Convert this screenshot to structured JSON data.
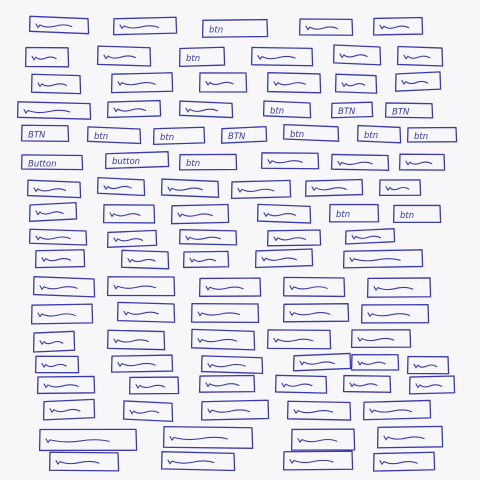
{
  "ink_color": "#3a3aa8",
  "paper_color": "#f7f7f9",
  "rows": [
    {
      "boxes": [
        {
          "label": ""
        },
        {
          "label": ""
        },
        {
          "label": "btn"
        },
        {
          "label": ""
        },
        {
          "label": ""
        }
      ]
    },
    {
      "boxes": [
        {
          "label": ""
        },
        {
          "label": ""
        },
        {
          "label": "btn"
        },
        {
          "label": ""
        },
        {
          "label": ""
        },
        {
          "label": ""
        }
      ]
    },
    {
      "boxes": [
        {
          "label": ""
        },
        {
          "label": ""
        },
        {
          "label": ""
        },
        {
          "label": ""
        },
        {
          "label": ""
        },
        {
          "label": ""
        }
      ]
    },
    {
      "boxes": [
        {
          "label": ""
        },
        {
          "label": ""
        },
        {
          "label": ""
        },
        {
          "label": "btn"
        },
        {
          "label": "BTN"
        },
        {
          "label": "BTN"
        }
      ]
    },
    {
      "boxes": [
        {
          "label": "BTN"
        },
        {
          "label": "btn"
        },
        {
          "label": "btn"
        },
        {
          "label": "BTN"
        },
        {
          "label": "btn"
        },
        {
          "label": "btn"
        },
        {
          "label": "btn"
        }
      ]
    },
    {
      "boxes": [
        {
          "label": "Button"
        },
        {
          "label": "button"
        },
        {
          "label": "btn"
        },
        {
          "label": ""
        },
        {
          "label": ""
        },
        {
          "label": ""
        },
        {
          "label": ""
        }
      ]
    },
    {
      "boxes": [
        {
          "label": ""
        },
        {
          "label": ""
        },
        {
          "label": ""
        },
        {
          "label": ""
        },
        {
          "label": ""
        },
        {
          "label": ""
        }
      ]
    },
    {
      "boxes": [
        {
          "label": ""
        },
        {
          "label": ""
        },
        {
          "label": ""
        },
        {
          "label": ""
        },
        {
          "label": "btn"
        },
        {
          "label": "btn"
        }
      ]
    },
    {
      "boxes": [
        {
          "label": ""
        },
        {
          "label": ""
        },
        {
          "label": ""
        },
        {
          "label": ""
        },
        {
          "label": ""
        }
      ]
    },
    {
      "boxes": [
        {
          "label": ""
        },
        {
          "label": ""
        },
        {
          "label": ""
        },
        {
          "label": ""
        },
        {
          "label": ""
        }
      ]
    },
    {
      "boxes": [
        {
          "label": ""
        },
        {
          "label": ""
        },
        {
          "label": ""
        },
        {
          "label": ""
        },
        {
          "label": ""
        }
      ]
    },
    {
      "boxes": [
        {
          "label": ""
        },
        {
          "label": ""
        },
        {
          "label": ""
        },
        {
          "label": ""
        },
        {
          "label": ""
        }
      ]
    },
    {
      "boxes": [
        {
          "label": ""
        },
        {
          "label": ""
        },
        {
          "label": ""
        },
        {
          "label": ""
        },
        {
          "label": ""
        }
      ]
    },
    {
      "boxes": [
        {
          "label": ""
        },
        {
          "label": ""
        },
        {
          "label": ""
        },
        {
          "label": ""
        },
        {
          "label": ""
        },
        {
          "label": ""
        }
      ]
    },
    {
      "boxes": [
        {
          "label": ""
        },
        {
          "label": ""
        },
        {
          "label": ""
        },
        {
          "label": ""
        },
        {
          "label": ""
        },
        {
          "label": ""
        }
      ]
    },
    {
      "boxes": [
        {
          "label": ""
        },
        {
          "label": ""
        },
        {
          "label": ""
        },
        {
          "label": ""
        },
        {
          "label": ""
        }
      ]
    },
    {
      "boxes": [
        {
          "label": ""
        },
        {
          "label": ""
        },
        {
          "label": ""
        },
        {
          "label": ""
        }
      ]
    },
    {
      "boxes": [
        {
          "label": ""
        },
        {
          "label": ""
        },
        {
          "label": ""
        },
        {
          "label": ""
        }
      ]
    }
  ]
}
